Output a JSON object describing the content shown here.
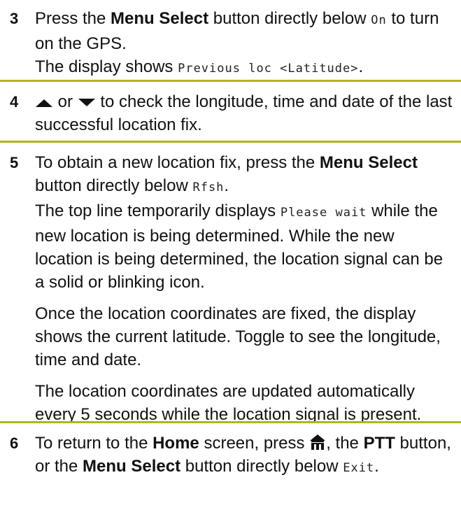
{
  "step3": {
    "number": "3",
    "t1": "Press the ",
    "b1": "Menu Select",
    "t2": " button directly below ",
    "m1": "On",
    "t3": " to turn on the GPS.",
    "t4": "The display shows ",
    "m2": "Previous loc <Latitude>",
    "t5": "."
  },
  "step4": {
    "number": "4",
    "or": " or ",
    "t1": " to check the longitude, time and date of the last successful location fix."
  },
  "step5": {
    "number": "5",
    "t1": "To obtain a new location fix, press the ",
    "b1": "Menu Select",
    "t2": " button directly below ",
    "m1": "Rfsh",
    "t3": ".",
    "t4": "The top line temporarily displays ",
    "m2": "Please wait",
    "t5": " while the new location is being determined. While the new location is being determined, the location signal can be a solid or blinking icon.",
    "p2": "Once the location coordinates are fixed, the display shows the current latitude. Toggle to see the longitude, time and date.",
    "p3": "The location coordinates are updated automatically every 5 seconds while the location signal is present."
  },
  "step6": {
    "number": "6",
    "t1": "To return to the ",
    "b1": "Home",
    "t2": " screen, press ",
    "t3": ", the ",
    "b2": "PTT",
    "t4": " button, or the ",
    "b3": "Menu Select",
    "t5": " button directly below ",
    "m1": "Exit",
    "t6": "."
  },
  "colors": {
    "rule": "#b5b21f",
    "text": "#111111"
  },
  "icons": [
    "arrow-up-icon",
    "arrow-down-icon",
    "home-icon"
  ]
}
